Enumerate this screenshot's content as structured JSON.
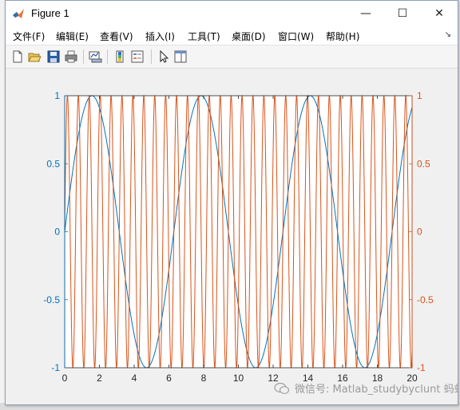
{
  "window": {
    "title": "Figure 1",
    "controls": {
      "minimize": "—",
      "maximize": "☐",
      "close": "✕"
    }
  },
  "menu": {
    "items": [
      "文件(F)",
      "编辑(E)",
      "查看(V)",
      "插入(I)",
      "工具(T)",
      "桌面(D)",
      "窗口(W)",
      "帮助(H)"
    ],
    "overflow_arrow": "↘"
  },
  "toolbar": {
    "buttons": [
      "new-figure-icon",
      "open-file-icon",
      "save-icon",
      "print-icon",
      "link-plot-icon",
      "colorbar-icon",
      "legend-icon",
      "edit-plot-arrow-icon",
      "property-editor-icon"
    ]
  },
  "watermark": {
    "text": "微信号: Matlab_studybyclunt 蚂蚁加技术社区"
  },
  "colors": {
    "left_series": "#0072BD",
    "right_series": "#D95319",
    "axes_background": "#ffffff",
    "figure_background": "#f0f0f0"
  },
  "chart_data": {
    "type": "line",
    "xlim": [
      0,
      20
    ],
    "xticks": [
      "0",
      "2",
      "4",
      "6",
      "8",
      "10",
      "12",
      "14",
      "16",
      "18",
      "20"
    ],
    "left_axis": {
      "ylim": [
        -1,
        1
      ],
      "yticks": [
        "-1",
        "-0.5",
        "0",
        "0.5",
        "1"
      ],
      "color": "#0072BD"
    },
    "right_axis": {
      "ylim": [
        -1,
        1
      ],
      "yticks": [
        "-1",
        "-0.5",
        "0",
        "0.5",
        "1"
      ],
      "color": "#D95319"
    },
    "grid": false,
    "legend": "none",
    "series": [
      {
        "axis": "left",
        "function": "sin(x)",
        "x_start": 0,
        "x_end": 20,
        "periods_in_range": 3.18
      },
      {
        "axis": "right",
        "function": "sin(10*x)",
        "x_start": 0,
        "x_end": 20,
        "periods_in_range": 31.8
      }
    ]
  }
}
